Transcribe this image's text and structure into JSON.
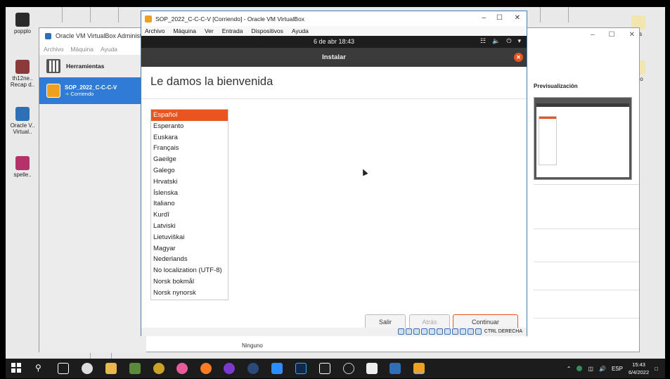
{
  "desktop": {
    "icons": [
      {
        "label": "popplo",
        "color": "#2b2b2b"
      },
      {
        "label": "th12ne.. Recap d..",
        "color": "#8a3a3a"
      },
      {
        "label": "Oracle V.. Virtual..",
        "color": "#2f6fb5"
      },
      {
        "label": "spelle..",
        "color": "#b5316a"
      }
    ],
    "right_icons": [
      {
        "label": "ias"
      },
      {
        "label": "ado"
      }
    ]
  },
  "manager": {
    "title": "Oracle VM VirtualBox Administrador",
    "menu": [
      "Archivo",
      "Máquina",
      "Ayuda"
    ],
    "tools_label": "Herramientas",
    "vm_name": "SOP_2022_C-C-C-V",
    "vm_state": "Corriendo",
    "preview_title": "Previsualización",
    "storage_value": "Ninguno"
  },
  "vm_window": {
    "title": "SOP_2022_C-C-C-V [Corriendo] - Oracle VM VirtualBox",
    "menu": [
      "Archivo",
      "Máquina",
      "Ver",
      "Entrada",
      "Dispositivos",
      "Ayuda"
    ],
    "clock": "6 de abr  18:43",
    "installer_title": "Instalar",
    "welcome": "Le damos la bienvenida",
    "languages": [
      "Español",
      "Esperanto",
      "Euskara",
      "Français",
      "Gaeilge",
      "Galego",
      "Hrvatski",
      "Íslenska",
      "Italiano",
      "Kurdî",
      "Latviski",
      "Lietuviškai",
      "Magyar",
      "Nederlands",
      "No localization (UTF-8)",
      "Norsk bokmål",
      "Norsk nynorsk"
    ],
    "selected_language": "Español",
    "buttons": {
      "quit": "Salir",
      "back": "Atrás",
      "continue": "Continuar"
    },
    "host_key": "CTRL DERECHA"
  },
  "taskbar": {
    "tray_lang": "ESP",
    "time": "15:43",
    "date": "6/4/2022"
  },
  "colors": {
    "accent": "#e95420",
    "selection_blue": "#2f7bd6"
  }
}
